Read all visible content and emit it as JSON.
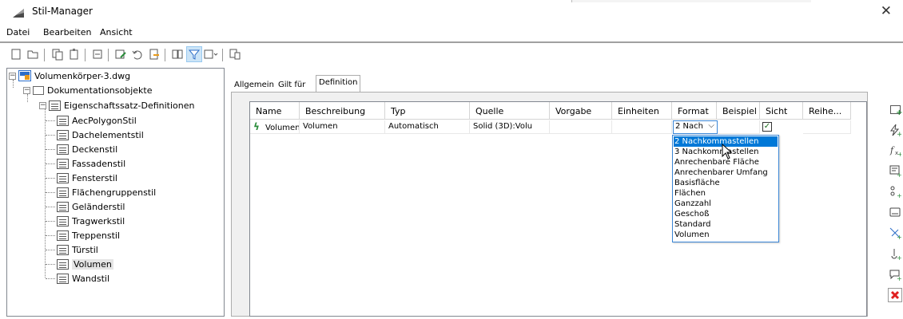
{
  "window": {
    "title": "Stil-Manager",
    "close_glyph": "✕"
  },
  "menu": [
    "Datei",
    "Bearbeiten",
    "Ansicht"
  ],
  "tree": {
    "root": "Volumenkörper-3.dwg",
    "level1": "Dokumentationsobjekte",
    "level2": "Eigenschaftssatz-Definitionen",
    "items": [
      "AecPolygonStil",
      "Dachelementstil",
      "Deckenstil",
      "Fassadenstil",
      "Fensterstil",
      "Flächengruppenstil",
      "Geländerstil",
      "Tragwerkstil",
      "Treppenstil",
      "Türstil",
      "Volumen",
      "Wandstil"
    ],
    "selected": "Volumen"
  },
  "tabs": [
    "Allgemein",
    "Gilt für",
    "Definition"
  ],
  "active_tab": "Definition",
  "grid": {
    "columns": [
      "Name",
      "Beschreibung",
      "Typ",
      "Quelle",
      "Vorgabe",
      "Einheiten",
      "Format",
      "Beispiel",
      "Sicht",
      "Reihe..."
    ],
    "row": {
      "name": "Volumen",
      "beschreibung": "Volumen",
      "typ": "Automatisch",
      "quelle": "Solid (3D):Volu",
      "vorgabe": "",
      "einheiten": "",
      "format": "2 Nach",
      "beispiel": "",
      "sicht_checked": true,
      "reihe": ""
    }
  },
  "format_dropdown": {
    "options": [
      "2 Nachkommastellen",
      "3 Nachkommastellen",
      "Anrechenbare Fläche",
      "Anrechenbarer Umfang",
      "Basisfläche",
      "Flächen",
      "Ganzzahl",
      "Geschoß",
      "Standard",
      "Volumen"
    ],
    "highlighted": "2 Nachkommastellen"
  },
  "icons": {
    "toolbar": [
      "new-icon",
      "open-icon",
      "copy-icon",
      "paste-icon",
      "purge-icon",
      "edit-icon",
      "undo-icon",
      "export-icon",
      "view-icon",
      "filter-icon",
      "toggle-view-icon",
      "display-icon"
    ],
    "side": [
      "add-property-icon",
      "add-automatic-property-icon",
      "add-formula-icon",
      "add-classification-icon",
      "add-location-icon",
      "add-graphic-icon",
      "add-anchor-icon",
      "add-group-icon",
      "add-material-icon",
      "delete-icon"
    ]
  },
  "colors": {
    "selection": "#0078d7",
    "focus_border": "#3a86d6",
    "delete_red": "#e02020",
    "add_green": "#2a8c3a"
  }
}
